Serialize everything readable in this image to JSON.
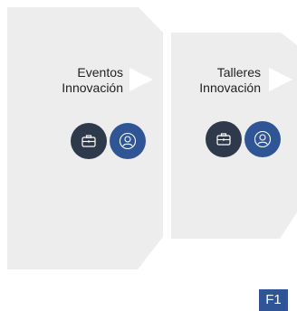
{
  "colors": {
    "card_background": "#ededed",
    "arrow": "#ffffff",
    "dark_button": "#2e3a4b",
    "blue_button": "#2f5597",
    "badge": "#2f5597"
  },
  "cards": [
    {
      "title_line1": "Eventos",
      "title_line2": "Innovación",
      "buttons": [
        "briefcase-icon",
        "user-icon"
      ]
    },
    {
      "title_line1": "Talleres",
      "title_line2": "Innovación",
      "buttons": [
        "briefcase-icon",
        "user-icon"
      ]
    }
  ],
  "badge": {
    "label": "F1"
  }
}
